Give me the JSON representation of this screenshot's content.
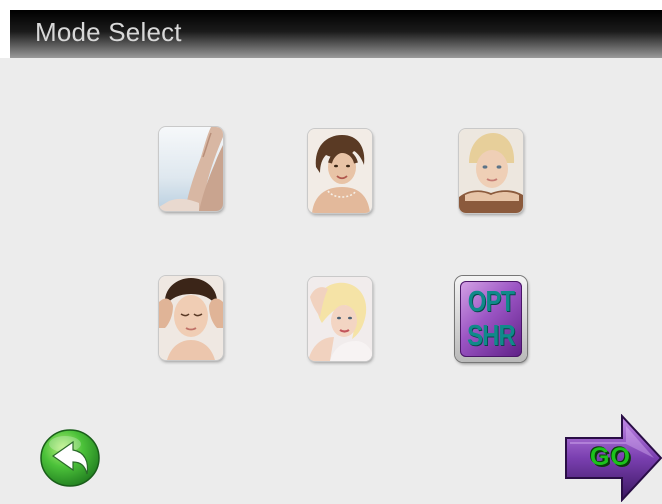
{
  "header": {
    "title": "Mode Select"
  },
  "modes": [
    {
      "id": "legs",
      "icon": "legs-photo-icon"
    },
    {
      "id": "face-smile",
      "icon": "woman-portrait-photo-icon"
    },
    {
      "id": "spa-face",
      "icon": "spa-face-photo-icon"
    },
    {
      "id": "facial-massage",
      "icon": "facial-massage-photo-icon"
    },
    {
      "id": "blonde",
      "icon": "blonde-woman-photo-icon"
    },
    {
      "id": "opt-shr",
      "icon": "opt-shr-icon",
      "label_line1": "OPT",
      "label_line2": "SHR"
    }
  ],
  "footer": {
    "back_icon": "back-arrow-icon",
    "go_label": "GO",
    "go_icon": "go-arrow-icon"
  },
  "colors": {
    "background": "#ececec",
    "title_text": "#d8d8d8",
    "opt_text": "#0f8a8a",
    "opt_bg": "#9b55c4",
    "back_green": "#3bb53b",
    "go_arrow": "#7a3fb0",
    "go_text": "#1cc21c"
  }
}
